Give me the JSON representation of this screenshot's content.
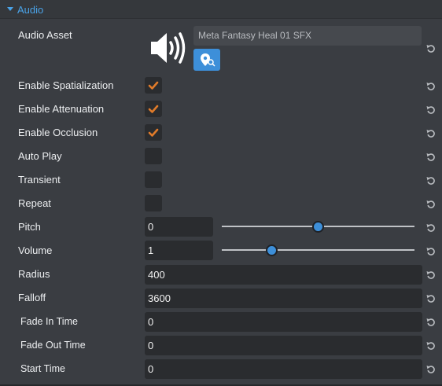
{
  "section": {
    "title": "Audio"
  },
  "asset": {
    "label": "Audio Asset",
    "name": "Meta Fantasy Heal 01 SFX"
  },
  "properties": {
    "enable_spatialization": {
      "label": "Enable Spatialization",
      "checked": true
    },
    "enable_attenuation": {
      "label": "Enable Attenuation",
      "checked": true
    },
    "enable_occlusion": {
      "label": "Enable Occlusion",
      "checked": true
    },
    "auto_play": {
      "label": "Auto Play",
      "checked": false
    },
    "transient": {
      "label": "Transient",
      "checked": false
    },
    "repeat": {
      "label": "Repeat",
      "checked": false
    },
    "pitch": {
      "label": "Pitch",
      "value": "0",
      "slider_fraction": 0.5
    },
    "volume": {
      "label": "Volume",
      "value": "1",
      "slider_fraction": 0.26
    },
    "radius": {
      "label": "Radius",
      "value": "400"
    },
    "falloff": {
      "label": "Falloff",
      "value": "3600"
    },
    "fade_in_time": {
      "label": "Fade In Time",
      "value": "0"
    },
    "fade_out_time": {
      "label": "Fade Out Time",
      "value": "0"
    },
    "start_time": {
      "label": "Start Time",
      "value": "0"
    }
  },
  "colors": {
    "accent": "#4aa3e8",
    "checkmark": "#e07b2a",
    "button": "#3d8fd9"
  },
  "icons": {
    "section_toggle": "triangle-down-icon",
    "speaker": "speaker-icon",
    "locate": "map-pin-icon",
    "checkmark": "checkmark-icon",
    "reset": "reset-icon"
  }
}
